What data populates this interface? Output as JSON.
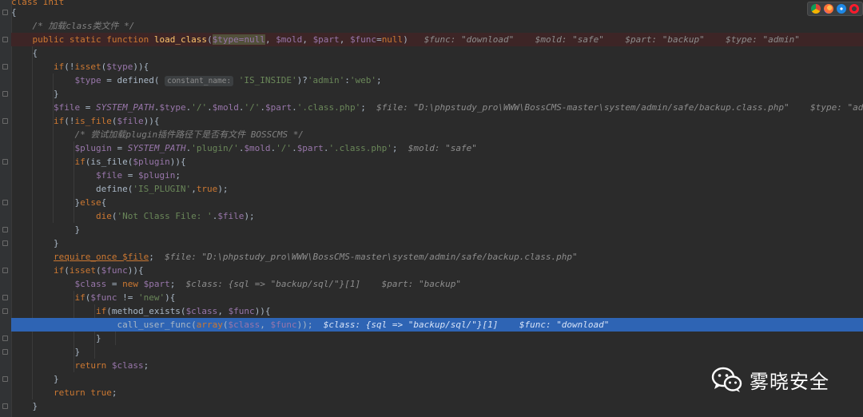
{
  "editor": {
    "top_fragment": "class Init",
    "lines": [
      {
        "segments": [
          {
            "c": "plain",
            "t": "{"
          }
        ]
      },
      {
        "segments": [
          {
            "c": "plain",
            "t": "    "
          },
          {
            "c": "cm",
            "t": "/* 加载class类文件 */"
          }
        ]
      },
      {
        "segments": [
          {
            "c": "plain",
            "t": "    "
          },
          {
            "c": "kw",
            "t": "public static function "
          },
          {
            "c": "fn",
            "t": "load_class"
          },
          {
            "c": "plain",
            "t": "("
          },
          {
            "c": "hl",
            "t": "$type="
          },
          {
            "c": "kw hl",
            "t": "null"
          },
          {
            "c": "plain",
            "t": ", "
          },
          {
            "c": "var",
            "t": "$mold"
          },
          {
            "c": "plain",
            "t": ", "
          },
          {
            "c": "var",
            "t": "$part"
          },
          {
            "c": "plain",
            "t": ", "
          },
          {
            "c": "var",
            "t": "$func"
          },
          {
            "c": "plain",
            "t": "="
          },
          {
            "c": "kw",
            "t": "null"
          },
          {
            "c": "plain",
            "t": ")   "
          },
          {
            "c": "hint",
            "t": "$func: \"download\"    $mold: \"safe\"    $part: \"backup\"    $type: \"admin\""
          }
        ]
      },
      {
        "segments": [
          {
            "c": "plain",
            "t": "    {"
          }
        ]
      },
      {
        "segments": [
          {
            "c": "plain",
            "t": "        "
          },
          {
            "c": "kw",
            "t": "if"
          },
          {
            "c": "plain",
            "t": "(!"
          },
          {
            "c": "kw",
            "t": "isset"
          },
          {
            "c": "plain",
            "t": "("
          },
          {
            "c": "var",
            "t": "$type"
          },
          {
            "c": "plain",
            "t": ")){"
          }
        ]
      },
      {
        "segments": [
          {
            "c": "plain",
            "t": "            "
          },
          {
            "c": "var",
            "t": "$type"
          },
          {
            "c": "plain",
            "t": " = defined( "
          },
          {
            "c": "chip",
            "t": "constant_name:"
          },
          {
            "c": "str",
            "t": " 'IS_INSIDE'"
          },
          {
            "c": "plain",
            "t": ")?"
          },
          {
            "c": "str",
            "t": "'admin'"
          },
          {
            "c": "plain",
            "t": ":"
          },
          {
            "c": "str",
            "t": "'web'"
          },
          {
            "c": "plain",
            "t": ";"
          }
        ]
      },
      {
        "segments": [
          {
            "c": "plain",
            "t": "        }"
          }
        ]
      },
      {
        "segments": [
          {
            "c": "plain",
            "t": "        "
          },
          {
            "c": "var",
            "t": "$file"
          },
          {
            "c": "plain",
            "t": " = "
          },
          {
            "c": "cn",
            "t": "SYSTEM_PATH"
          },
          {
            "c": "plain",
            "t": "."
          },
          {
            "c": "var",
            "t": "$type"
          },
          {
            "c": "plain",
            "t": "."
          },
          {
            "c": "str",
            "t": "'/'"
          },
          {
            "c": "plain",
            "t": "."
          },
          {
            "c": "var",
            "t": "$mold"
          },
          {
            "c": "plain",
            "t": "."
          },
          {
            "c": "str",
            "t": "'/'"
          },
          {
            "c": "plain",
            "t": "."
          },
          {
            "c": "var",
            "t": "$part"
          },
          {
            "c": "plain",
            "t": "."
          },
          {
            "c": "str",
            "t": "'.class.php'"
          },
          {
            "c": "plain",
            "t": ";  "
          },
          {
            "c": "hint",
            "t": "$file: \"D:\\phpstudy_pro\\WWW\\BossCMS-master\\system/admin/safe/backup.class.php\"    $type: \"admin\""
          }
        ]
      },
      {
        "segments": [
          {
            "c": "plain",
            "t": "        "
          },
          {
            "c": "kw",
            "t": "if"
          },
          {
            "c": "plain",
            "t": "(!"
          },
          {
            "c": "kw",
            "t": "is_file"
          },
          {
            "c": "plain",
            "t": "("
          },
          {
            "c": "var",
            "t": "$file"
          },
          {
            "c": "plain",
            "t": ")){"
          }
        ]
      },
      {
        "segments": [
          {
            "c": "plain",
            "t": "            "
          },
          {
            "c": "cm",
            "t": "/* 尝试加载plugin插件路径下是否有文件 BOSSCMS */"
          }
        ]
      },
      {
        "segments": [
          {
            "c": "plain",
            "t": "            "
          },
          {
            "c": "var",
            "t": "$plugin"
          },
          {
            "c": "plain",
            "t": " = "
          },
          {
            "c": "cn",
            "t": "SYSTEM_PATH"
          },
          {
            "c": "plain",
            "t": "."
          },
          {
            "c": "str",
            "t": "'plugin/'"
          },
          {
            "c": "plain",
            "t": "."
          },
          {
            "c": "var",
            "t": "$mold"
          },
          {
            "c": "plain",
            "t": "."
          },
          {
            "c": "str",
            "t": "'/'"
          },
          {
            "c": "plain",
            "t": "."
          },
          {
            "c": "var",
            "t": "$part"
          },
          {
            "c": "plain",
            "t": "."
          },
          {
            "c": "str",
            "t": "'.class.php'"
          },
          {
            "c": "plain",
            "t": ";  "
          },
          {
            "c": "hint",
            "t": "$mold: \"safe\""
          }
        ]
      },
      {
        "segments": [
          {
            "c": "plain",
            "t": "            "
          },
          {
            "c": "kw",
            "t": "if"
          },
          {
            "c": "plain",
            "t": "(is_file("
          },
          {
            "c": "var",
            "t": "$plugin"
          },
          {
            "c": "plain",
            "t": ")){"
          }
        ]
      },
      {
        "segments": [
          {
            "c": "plain",
            "t": "                "
          },
          {
            "c": "var",
            "t": "$file"
          },
          {
            "c": "plain",
            "t": " = "
          },
          {
            "c": "var",
            "t": "$plugin"
          },
          {
            "c": "plain",
            "t": ";"
          }
        ]
      },
      {
        "segments": [
          {
            "c": "plain",
            "t": "                define("
          },
          {
            "c": "str",
            "t": "'IS_PLUGIN'"
          },
          {
            "c": "plain",
            "t": ","
          },
          {
            "c": "kw",
            "t": "true"
          },
          {
            "c": "plain",
            "t": ");"
          }
        ]
      },
      {
        "segments": [
          {
            "c": "plain",
            "t": "            }"
          },
          {
            "c": "kw",
            "t": "else"
          },
          {
            "c": "plain",
            "t": "{"
          }
        ]
      },
      {
        "segments": [
          {
            "c": "plain",
            "t": "                "
          },
          {
            "c": "kw",
            "t": "die"
          },
          {
            "c": "plain",
            "t": "("
          },
          {
            "c": "str",
            "t": "'Not Class File: '"
          },
          {
            "c": "plain",
            "t": "."
          },
          {
            "c": "var",
            "t": "$file"
          },
          {
            "c": "plain",
            "t": ");"
          }
        ]
      },
      {
        "segments": [
          {
            "c": "plain",
            "t": "            }"
          }
        ]
      },
      {
        "segments": [
          {
            "c": "plain",
            "t": "        }"
          }
        ]
      },
      {
        "segments": [
          {
            "c": "plain",
            "t": "        "
          },
          {
            "c": "ul",
            "t": "require_once "
          },
          {
            "c": "var ul",
            "t": "$file"
          },
          {
            "c": "plain",
            "t": ";  "
          },
          {
            "c": "hint",
            "t": "$file: \"D:\\phpstudy_pro\\WWW\\BossCMS-master\\system/admin/safe/backup.class.php\""
          }
        ]
      },
      {
        "segments": [
          {
            "c": "plain",
            "t": "        "
          },
          {
            "c": "kw",
            "t": "if"
          },
          {
            "c": "plain",
            "t": "("
          },
          {
            "c": "kw",
            "t": "isset"
          },
          {
            "c": "plain",
            "t": "("
          },
          {
            "c": "var",
            "t": "$func"
          },
          {
            "c": "plain",
            "t": ")){"
          }
        ]
      },
      {
        "segments": [
          {
            "c": "plain",
            "t": "            "
          },
          {
            "c": "var",
            "t": "$class"
          },
          {
            "c": "plain",
            "t": " = "
          },
          {
            "c": "kw",
            "t": "new "
          },
          {
            "c": "var",
            "t": "$part"
          },
          {
            "c": "plain",
            "t": ";  "
          },
          {
            "c": "hint",
            "t": "$class: {sql => \"backup/sql/\"}[1]    $part: \"backup\""
          }
        ]
      },
      {
        "segments": [
          {
            "c": "plain",
            "t": "            "
          },
          {
            "c": "kw",
            "t": "if"
          },
          {
            "c": "plain",
            "t": "("
          },
          {
            "c": "var",
            "t": "$func"
          },
          {
            "c": "plain",
            "t": " != "
          },
          {
            "c": "str",
            "t": "'new'"
          },
          {
            "c": "plain",
            "t": "){"
          }
        ]
      },
      {
        "segments": [
          {
            "c": "plain",
            "t": "                "
          },
          {
            "c": "kw",
            "t": "if"
          },
          {
            "c": "plain",
            "t": "(method_exists("
          },
          {
            "c": "var",
            "t": "$class"
          },
          {
            "c": "plain",
            "t": ", "
          },
          {
            "c": "var",
            "t": "$func"
          },
          {
            "c": "plain",
            "t": ")){"
          }
        ]
      },
      {
        "segments": [
          {
            "c": "plain",
            "t": "                    call_user_func("
          },
          {
            "c": "kw",
            "t": "array"
          },
          {
            "c": "plain",
            "t": "("
          },
          {
            "c": "var",
            "t": "$class"
          },
          {
            "c": "plain",
            "t": ", "
          },
          {
            "c": "var",
            "t": "$func"
          },
          {
            "c": "plain",
            "t": "));  "
          },
          {
            "c": "hint",
            "t": "$class: {sql => \"backup/sql/\"}[1]    $func: \"download\""
          }
        ]
      },
      {
        "segments": [
          {
            "c": "plain",
            "t": "                }"
          }
        ]
      },
      {
        "segments": [
          {
            "c": "plain",
            "t": "            }"
          }
        ]
      },
      {
        "segments": [
          {
            "c": "plain",
            "t": "            "
          },
          {
            "c": "kw",
            "t": "return "
          },
          {
            "c": "var",
            "t": "$class"
          },
          {
            "c": "plain",
            "t": ";"
          }
        ]
      },
      {
        "segments": [
          {
            "c": "plain",
            "t": "        }"
          }
        ]
      },
      {
        "segments": [
          {
            "c": "plain",
            "t": "        "
          },
          {
            "c": "kw",
            "t": "return true"
          },
          {
            "c": "plain",
            "t": ";"
          }
        ]
      },
      {
        "segments": [
          {
            "c": "plain",
            "t": "    }"
          }
        ]
      }
    ],
    "error_line_index": 2,
    "selected_line_index": 23
  },
  "browser_icons": [
    "chrome-icon",
    "firefox-icon",
    "safari-icon",
    "opera-icon"
  ],
  "watermark": {
    "text": "雾晓安全",
    "icon": "wechat-icon"
  },
  "colors": {
    "background": "#2b2b2b",
    "keyword": "#cc7832",
    "function": "#ffc66d",
    "variable": "#9876aa",
    "string": "#6a8759",
    "comment": "#808080",
    "selection": "#2e64b4",
    "error_line": "#3d2526"
  }
}
